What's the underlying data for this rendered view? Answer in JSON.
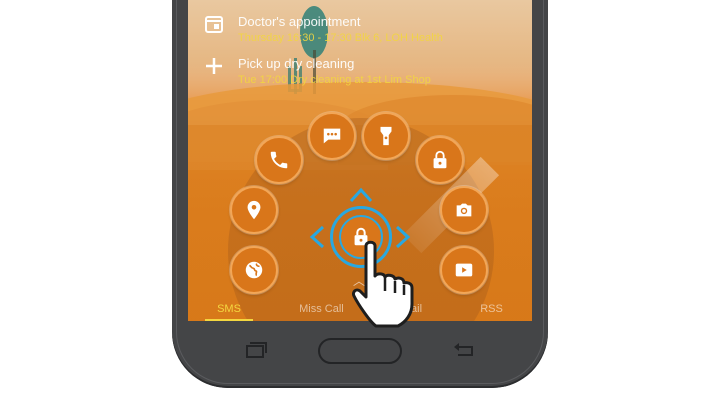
{
  "notifications": [
    {
      "title": "Doctor's appointment",
      "subtitle": "Thursday 16:30 - 17:30 Blk 6, LOH Health",
      "icon": "calendar-icon"
    },
    {
      "title": "Pick up dry cleaning",
      "subtitle": "Tue 17:00 Dry cleaning at 1st Lim Shop",
      "icon": "plus-icon"
    }
  ],
  "tabs": [
    "SMS",
    "Miss Call",
    "Mail",
    "RSS"
  ],
  "active_tab": "SMS",
  "shortcuts": [
    {
      "name": "message-shortcut",
      "icon": "message-icon"
    },
    {
      "name": "flashlight-shortcut",
      "icon": "flashlight-icon"
    },
    {
      "name": "phone-shortcut",
      "icon": "phone-icon"
    },
    {
      "name": "unlock-shortcut",
      "icon": "unlock-icon"
    },
    {
      "name": "location-shortcut",
      "icon": "location-pin-icon"
    },
    {
      "name": "camera-shortcut",
      "icon": "camera-icon"
    },
    {
      "name": "browser-shortcut",
      "icon": "globe-icon"
    },
    {
      "name": "video-shortcut",
      "icon": "play-icon"
    }
  ],
  "center": {
    "icon": "lock-icon"
  },
  "colors": {
    "accent": "#29a8e0",
    "button": "#d9761a",
    "highlight": "#f3d640",
    "phone_body": "#444547"
  }
}
